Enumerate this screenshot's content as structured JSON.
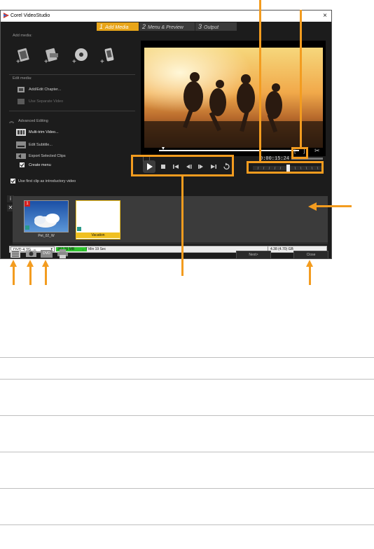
{
  "window": {
    "title": "Corel VideoStudio",
    "close_glyph": "×"
  },
  "tabs": [
    {
      "num": "1",
      "label": "Add Media"
    },
    {
      "num": "2",
      "label": "Menu & Preview"
    },
    {
      "num": "3",
      "label": "Output"
    }
  ],
  "left_panel": {
    "add_media_heading": "Add media:",
    "edit_media_heading": "Edit media:",
    "add_edit_chapter": "Add/Edit Chapter...",
    "use_separate_video": "Use Separate Video",
    "advanced_editing": "Advanced Editing",
    "multi_trim": "Multi-trim Video...",
    "edit_subtitle": "Edit Subtitle...",
    "export_selected": "Export Selected Clips",
    "create_menu": "Create menu",
    "use_first_clip": "Use first clip as introductory video"
  },
  "timecode": "0:00:15:24",
  "clips": [
    {
      "label": "Pet_02_W",
      "badge": "1"
    },
    {
      "label": "Vacation"
    }
  ],
  "status": {
    "disc_type": "DVD 4.7G",
    "used": "362.26 MB",
    "duration": "7 Min 19 Sec",
    "capacity": "4.38 (4.70) GB"
  },
  "buttons": {
    "next": "Next>",
    "close": "Close"
  },
  "bottom_tools": {
    "dvd_label": "DVD"
  },
  "colors": {
    "accent": "#f39c1f",
    "tab_active": "#e8a519",
    "window_bg": "#1c1c1c",
    "strip_bg": "#3b3b3b"
  }
}
